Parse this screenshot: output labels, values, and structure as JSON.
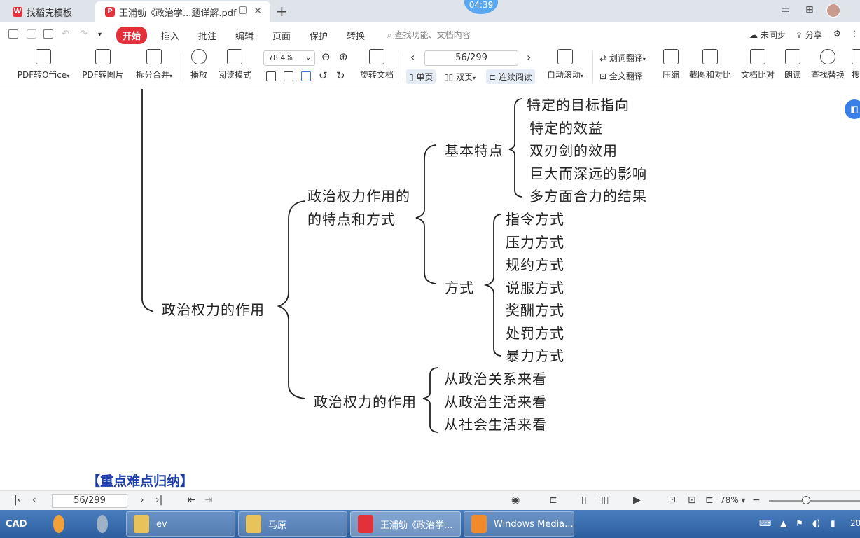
{
  "tabs": [
    {
      "label": "找稻壳模板"
    },
    {
      "label": "王浦劬《政治学...题详解.pdf"
    }
  ],
  "timer": "04:39",
  "menu": {
    "items": [
      "开始",
      "插入",
      "批注",
      "编辑",
      "页面",
      "保护",
      "转换"
    ],
    "search_placeholder": "查找功能、文档内容",
    "sync": "未同步",
    "share": "分享"
  },
  "toolbar": {
    "pdf_to_office": "PDF转Office",
    "pdf_to_image": "PDF转图片",
    "split_merge": "拆分合并",
    "play": "播放",
    "read_mode": "阅读模式",
    "zoom": "78.4%",
    "page": "56/299",
    "rotate": "旋转文档",
    "single_page": "单页",
    "double_page": "双页",
    "continuous": "连续阅读",
    "auto_scroll": "自动滚动",
    "word_translate": "划词翻译",
    "full_translate": "全文翻译",
    "compress": "压缩",
    "screenshot_compare": "截图和对比",
    "doc_compare": "文档比对",
    "read_aloud": "朗读",
    "find_replace": "查找替换",
    "overflow": "搜"
  },
  "document": {
    "root": "政治权力的作用",
    "branch1_line1": "政治权力作用的",
    "branch1_line2": "的特点和方式",
    "basic": "基本特点",
    "basic_items": [
      "特定的目标指向",
      "特定的效益",
      "双刃剑的效用",
      "巨大而深远的影响",
      "多方面合力的结果"
    ],
    "mode": "方式",
    "mode_items": [
      "指令方式",
      "压力方式",
      "规约方式",
      "说服方式",
      "奖酬方式",
      "处罚方式",
      "暴力方式"
    ],
    "branch2": "政治权力的作用",
    "branch2_items": [
      "从政治关系来看",
      "从政治生活来看",
      "从社会生活来看"
    ],
    "heading": "【重点难点归纳】"
  },
  "statusbar": {
    "page": "56/299",
    "zoom": "78%"
  },
  "taskbar": {
    "cad": "CAD",
    "items": [
      "ev",
      "马原",
      "王浦劬《政治学...",
      "Windows Media..."
    ],
    "clock": "20"
  }
}
